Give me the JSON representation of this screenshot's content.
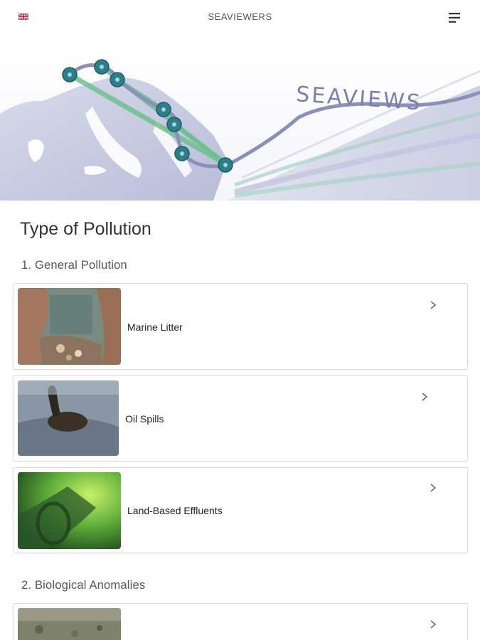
{
  "header": {
    "app_title": "SEAVIEWERS",
    "language_icon": "uk-flag-icon",
    "menu_icon": "hamburger-menu-icon"
  },
  "banner": {
    "logo_text": "SEAVIEWS"
  },
  "page": {
    "title": "Type of Pollution"
  },
  "sections": [
    {
      "title": "1. General Pollution",
      "items": [
        {
          "label": "Marine Litter",
          "icon": "chevron-right-icon"
        },
        {
          "label": "Oil Spills",
          "icon": "chevron-right-icon"
        },
        {
          "label": "Land-Based Effluents",
          "icon": "chevron-right-icon"
        }
      ]
    },
    {
      "title": "2. Biological Anomalies",
      "items": [
        {
          "label": "",
          "icon": "chevron-right-icon"
        }
      ]
    }
  ],
  "colors": {
    "banner_land": "#c9cbe2",
    "route_green": "#6fbf8f",
    "route_gray": "#8a90b8",
    "marker": "#2f7d8a"
  }
}
